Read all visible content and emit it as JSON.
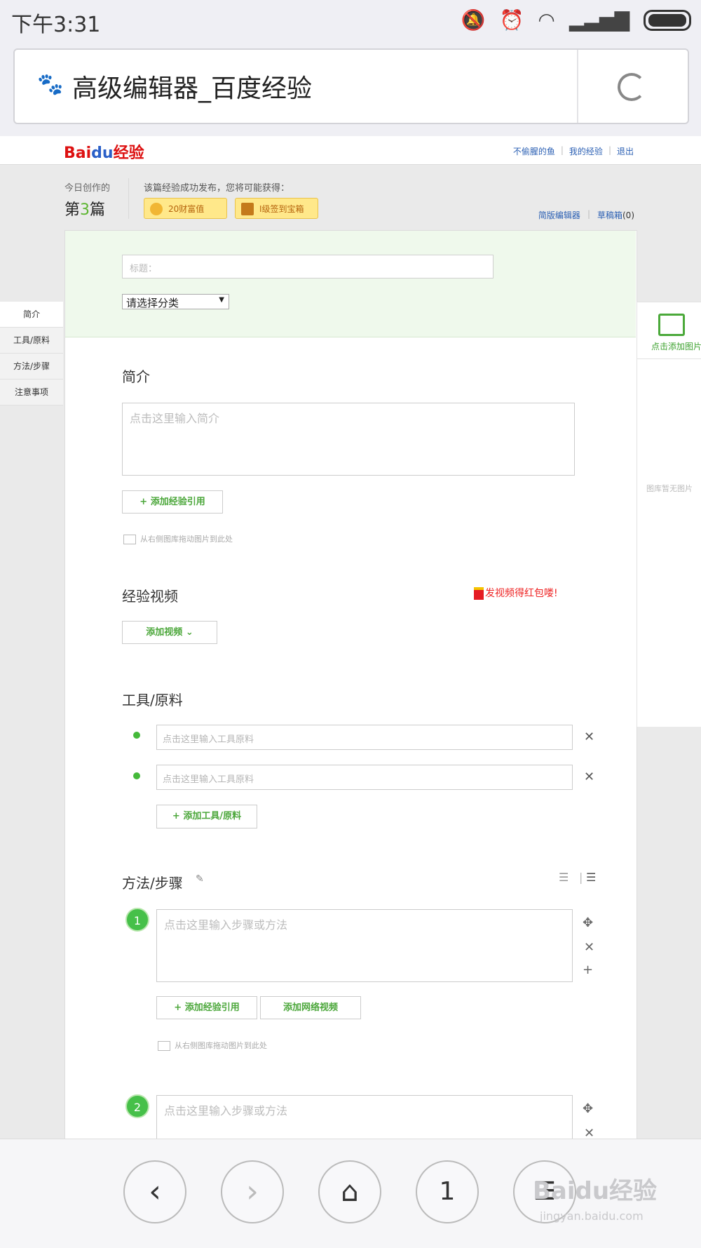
{
  "status_bar": {
    "time": "下午3:31"
  },
  "browser": {
    "page_title": "高级编辑器_百度经验"
  },
  "site": {
    "logo": {
      "left": "Bai",
      "mid": "du",
      "right": "经验"
    },
    "top_links": [
      "不偷腥的鱼",
      "我的经验",
      "退出"
    ]
  },
  "stats": {
    "today_label": "今日创作的",
    "today_prefix": "第",
    "today_num": "3",
    "today_suffix": "篇",
    "gain_label": "该篇经验成功发布，您将可能获得：",
    "badge_wealth": "20财富值",
    "badge_chest": "I级签到宝箱"
  },
  "editor_links": {
    "simple": "简版编辑器",
    "drafts": "草稿箱",
    "drafts_count": "(0)"
  },
  "form": {
    "title_placeholder": "标题：",
    "category_selected": "请选择分类"
  },
  "left_nav": [
    "简介",
    "工具/原料",
    "方法/步骤",
    "注意事项"
  ],
  "right_panel": {
    "add_image": "点击添加图片",
    "empty": "图库暂无图片"
  },
  "intro": {
    "heading": "简介",
    "placeholder": "点击这里输入简介",
    "add_ref": "+ 添加经验引用",
    "drag_hint": "从右侧图库拖动图片到此处"
  },
  "video": {
    "heading": "经验视频",
    "promo": "发视频得红包喽!",
    "add_video": "添加视频"
  },
  "tools": {
    "heading": "工具/原料",
    "items": [
      {
        "placeholder": "点击这里输入工具原料"
      },
      {
        "placeholder": "点击这里输入工具原料"
      }
    ],
    "add": "+ 添加工具/原料"
  },
  "steps": {
    "heading": "方法/步骤",
    "items": [
      {
        "num": "1",
        "placeholder": "点击这里输入步骤或方法"
      },
      {
        "num": "2",
        "placeholder": "点击这里输入步骤或方法"
      }
    ],
    "add_ref": "+ 添加经验引用",
    "add_web_video": "添加网络视频",
    "drag_hint": "从右侧图库拖动图片到此处"
  },
  "bottom_nav": {
    "tabs_count": "1"
  },
  "watermark": {
    "main": "Baidu经验",
    "url": "jingyan.baidu.com"
  },
  "colors": {
    "accent": "#4ca73b",
    "link": "#2a5fb3",
    "badge_bg": "#ffe88a"
  }
}
